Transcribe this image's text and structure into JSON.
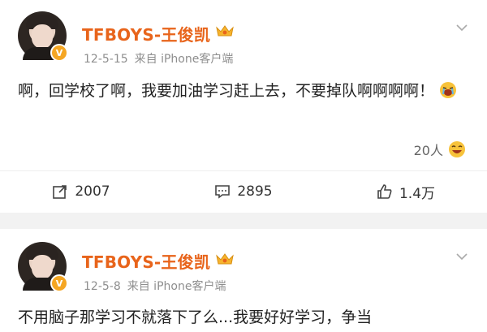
{
  "posts": [
    {
      "username": "TFBOYS-王俊凯",
      "date": "12-5-15",
      "source": "来自 iPhone客户端",
      "content": "啊，回学校了啊，我要加油学习赶上去，不要掉队啊啊啊啊！",
      "likes_text": "20人",
      "actions": {
        "repost_count": "2007",
        "comment_count": "2895",
        "like_count": "1.4万"
      }
    },
    {
      "username": "TFBOYS-王俊凯",
      "date": "12-5-8",
      "source": "来自 iPhone客户端",
      "content": "不用脑子那学习不就落下了么...我要好好学习，争当"
    }
  ],
  "colors": {
    "username": "#e8641b",
    "verified_badge": "#f5a623",
    "meta_text": "#8e8e8e",
    "separator": "#f2f2f2"
  },
  "icons": {
    "crown": "crown-icon",
    "verified": "verified-badge-icon",
    "chevron": "chevron-down-icon",
    "repost": "repost-icon",
    "comment": "comment-icon",
    "like": "thumb-up-icon"
  }
}
